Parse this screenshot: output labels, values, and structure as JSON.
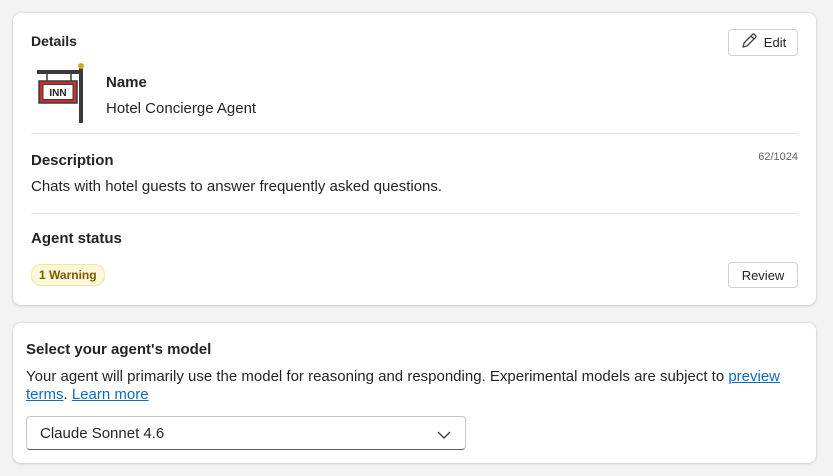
{
  "details": {
    "title": "Details",
    "edit_label": "Edit",
    "name_label": "Name",
    "name_value": "Hotel Concierge Agent",
    "description_label": "Description",
    "description_value": "Chats with hotel guests to answer frequently asked questions.",
    "char_count": "62/1024",
    "status_label": "Agent status",
    "warning_badge": "1 Warning",
    "review_label": "Review",
    "avatar_icon": "inn-sign-icon"
  },
  "model": {
    "title": "Select your agent's model",
    "description_prefix": "Your agent will primarily use the model for reasoning and responding. Experimental models are subject to ",
    "preview_link": "preview terms",
    "separator": ". ",
    "learn_more_link": "Learn more",
    "selected_model": "Claude Sonnet 4.6"
  },
  "colors": {
    "link": "#0f6cbd",
    "warning_bg": "#fdf6d9",
    "warning_text": "#7a5c00"
  }
}
